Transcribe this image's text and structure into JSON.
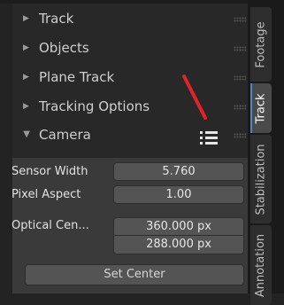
{
  "panels": [
    {
      "label": "Track",
      "state": "collapsed"
    },
    {
      "label": "Objects",
      "state": "collapsed"
    },
    {
      "label": "Plane Track",
      "state": "collapsed"
    },
    {
      "label": "Tracking Options",
      "state": "collapsed"
    },
    {
      "label": "Camera",
      "state": "expanded"
    }
  ],
  "camera": {
    "sensor_width_label": "Sensor Width",
    "sensor_width_value": "5.760",
    "pixel_aspect_label": "Pixel Aspect",
    "pixel_aspect_value": "1.00",
    "optical_center_label": "Optical Cen...",
    "optical_center_x": "360.000 px",
    "optical_center_y": "288.000 px",
    "set_center_label": "Set Center"
  },
  "tabs": [
    {
      "label": "Footage",
      "active": false
    },
    {
      "label": "Track",
      "active": true
    },
    {
      "label": "Stabilization",
      "active": false
    },
    {
      "label": "Annotation",
      "active": false
    }
  ],
  "colors": {
    "accent": "#4d86c6",
    "annotation_stroke": "#e0232b"
  }
}
